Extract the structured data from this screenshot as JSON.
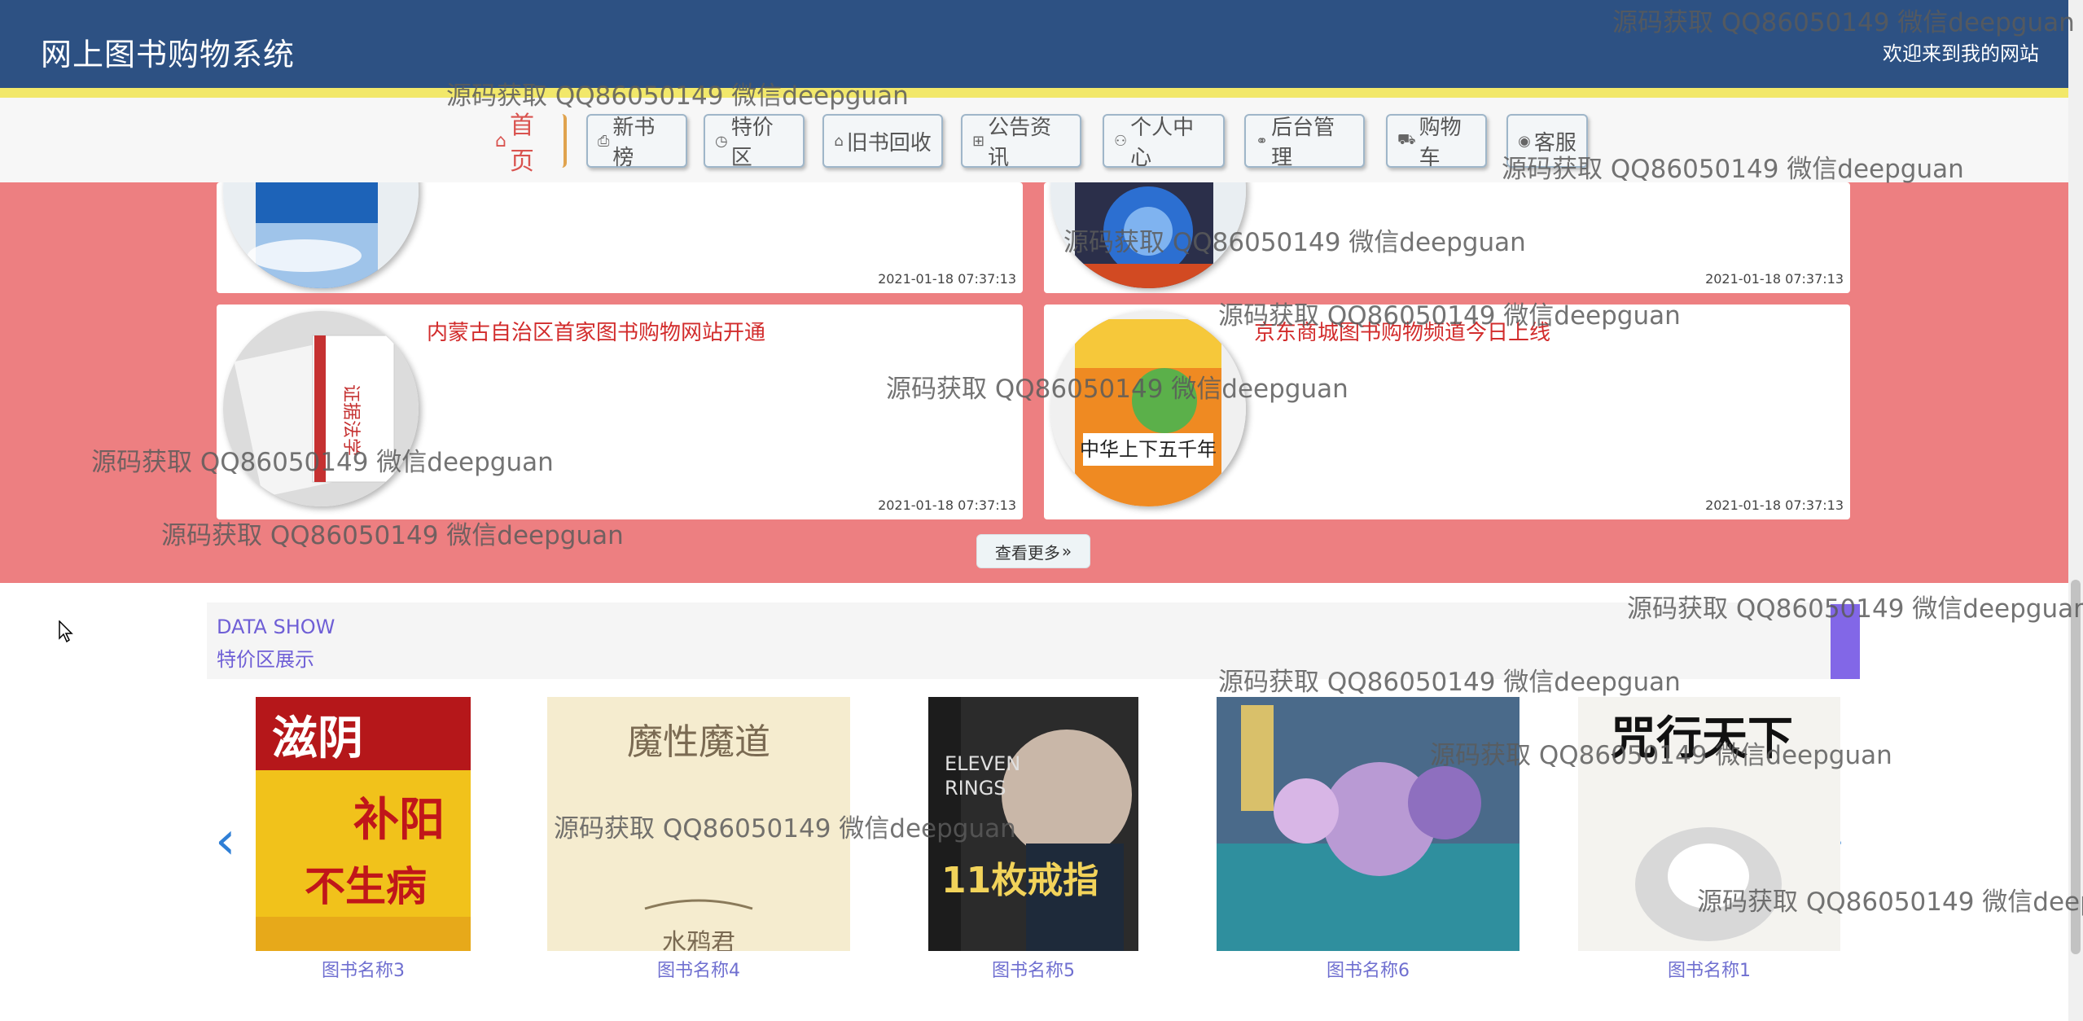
{
  "header": {
    "site_title": "网上图书购物系统",
    "welcome": "欢迎来到我的网站"
  },
  "nav": {
    "items": [
      {
        "label": "首页",
        "icon": "home-icon"
      },
      {
        "label": "新书榜",
        "icon": "printer-icon"
      },
      {
        "label": "特价区",
        "icon": "clock-icon"
      },
      {
        "label": "旧书回收",
        "icon": "tag-icon"
      },
      {
        "label": "公告资讯",
        "icon": "grid-icon"
      },
      {
        "label": "个人中心",
        "icon": "user-icon"
      },
      {
        "label": "后台管理",
        "icon": "link-icon"
      },
      {
        "label": "购物车",
        "icon": "cart-icon"
      },
      {
        "label": "客服",
        "icon": "chat-icon"
      }
    ]
  },
  "news": {
    "cards": [
      {
        "title": "",
        "time": "2021-01-18 07:37:13"
      },
      {
        "title": "",
        "time": "2021-01-18 07:37:13"
      },
      {
        "title": "内蒙古自治区首家图书购物网站开通",
        "time": "2021-01-18 07:37:13"
      },
      {
        "title": "京东商城图书购物频道今日上线",
        "time": "2021-01-18 07:37:13"
      }
    ],
    "more_label": "查看更多",
    "more_icon": "»"
  },
  "data_show": {
    "title_en": "DATA SHOW",
    "title_cn": "特价区展示",
    "books": [
      {
        "name": "图书名称3",
        "cover_text": "滋阴补阳不生病"
      },
      {
        "name": "图书名称4",
        "cover_text": "魔性魔道"
      },
      {
        "name": "图书名称5",
        "cover_text": "11枚戒指"
      },
      {
        "name": "图书名称6",
        "cover_text": ""
      },
      {
        "name": "图书名称1",
        "cover_text": "咒行天下"
      }
    ],
    "prev_icon": "‹",
    "next_icon": "›"
  },
  "watermark": "源码获取 QQ86050149 微信deepguan"
}
